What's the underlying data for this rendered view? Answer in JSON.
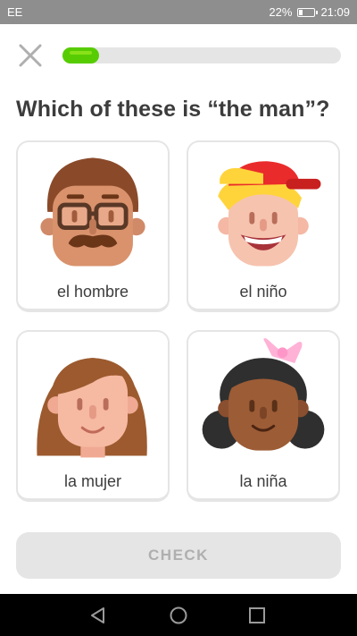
{
  "status_bar": {
    "carrier": "EE",
    "battery_percent": "22%",
    "battery_level": 0.22,
    "time": "21:09"
  },
  "lesson": {
    "progress": 0.13
  },
  "question": "Which of these is “the man”?",
  "options": [
    {
      "label": "el hombre",
      "icon": "man-with-glasses-icon"
    },
    {
      "label": "el niño",
      "icon": "boy-with-cap-icon"
    },
    {
      "label": "la mujer",
      "icon": "woman-icon"
    },
    {
      "label": "la niña",
      "icon": "girl-with-bow-icon"
    }
  ],
  "check_button": {
    "label": "CHECK"
  },
  "colors": {
    "progress": "#58cc02",
    "track": "#e5e5e5",
    "text": "#3c3c3c",
    "disabled_text": "#afafaf"
  }
}
